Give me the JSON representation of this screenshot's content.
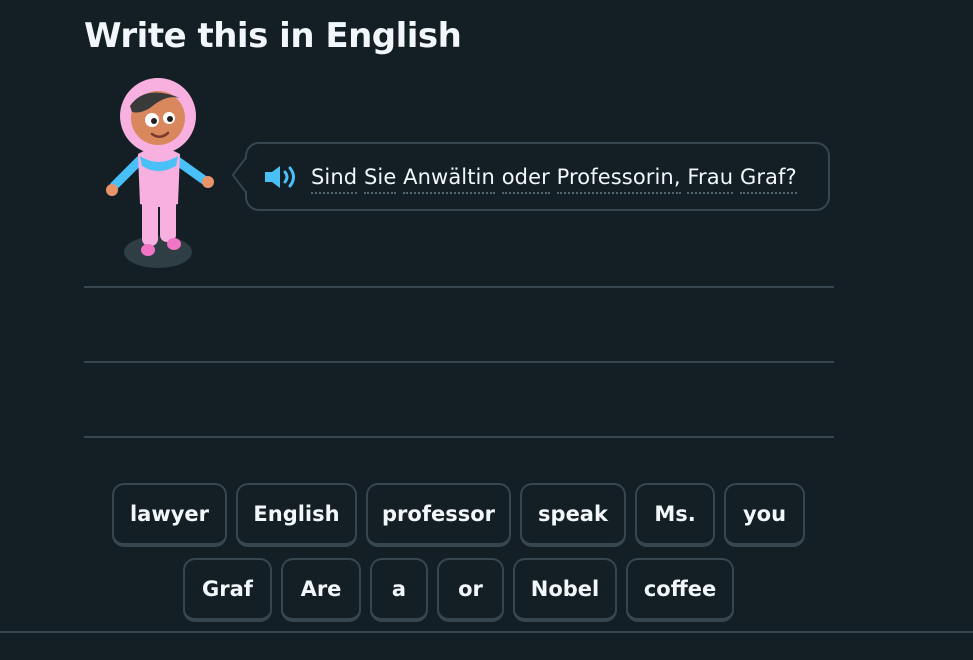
{
  "challenge": {
    "title": "Write this in English"
  },
  "prompt": {
    "words": [
      "Sind",
      "Sie",
      "Anwältin",
      "oder",
      "Professorin,",
      "Frau",
      "Graf?"
    ],
    "speaker_icon": "speaker-icon"
  },
  "word_bank": {
    "row1": [
      "lawyer",
      "English",
      "professor",
      "speak",
      "Ms.",
      "you"
    ],
    "row2": [
      "Graf",
      "Are",
      "a",
      "or",
      "Nobel",
      "coffee"
    ]
  },
  "colors": {
    "background": "#131f24",
    "border": "#37464f",
    "text": "#f1f7fb",
    "speaker": "#49c0f8",
    "character_pink": "#f5a3d8"
  }
}
